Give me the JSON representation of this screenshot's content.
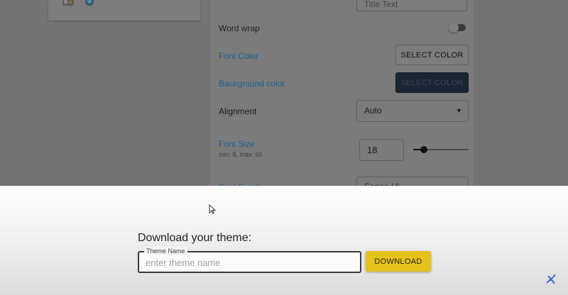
{
  "settings": {
    "title_text_value": "Title Text",
    "word_wrap_label": "Word wrap",
    "font_color_label": "Font Color",
    "font_color_button": "SELECT COLOR",
    "background_color_label": "Background color",
    "background_color_button": "SELECT COLOR",
    "alignment_label": "Alignment",
    "alignment_value": "Auto",
    "font_size_label": "Font Size",
    "font_size_hint": "min: 8, max: 60",
    "font_size_value": "18",
    "font_size_slider_fraction": 0.19,
    "font_family_label": "Font Family",
    "font_family_value": "Segoe UI",
    "word_wrap_on": false
  },
  "download": {
    "title": "Download your theme:",
    "field_label": "Theme Name",
    "field_placeholder": "enter theme name",
    "field_value": "",
    "button_label": "DOWNLOAD"
  },
  "colors": {
    "accent_blue": "#1a5f8c",
    "download_yellow": "#e8c21c",
    "dark_button": "#1a2533"
  },
  "icons": [
    "image-icon",
    "globe-icon",
    "toggle-switch",
    "chevron-down-icon",
    "mouse-cursor-icon",
    "brand-logo-icon"
  ]
}
